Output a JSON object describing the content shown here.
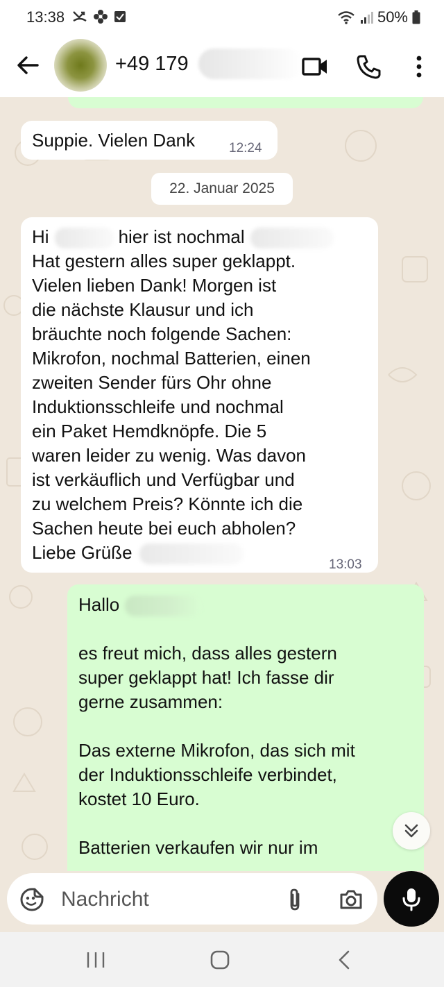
{
  "status_bar": {
    "time": "13:38",
    "battery": "50%",
    "icons": [
      "missed-call-icon",
      "flower-icon",
      "checkbox-icon",
      "wifi-icon",
      "signal-icon",
      "battery-icon"
    ]
  },
  "header": {
    "contact_number": "+49 179",
    "icons": [
      "back-arrow-icon",
      "video-call-icon",
      "phone-icon",
      "more-vertical-icon"
    ]
  },
  "messages": [
    {
      "direction": "incoming",
      "text": "Suppie. Vielen Dank",
      "time": "12:24"
    },
    {
      "type": "date",
      "text": "22. Januar 2025"
    },
    {
      "direction": "incoming",
      "lines": [
        "Hi",
        "hier ist nochmal",
        "Hat gestern alles super geklappt.",
        "Vielen lieben Dank! Morgen ist",
        "die nächste Klausur und ich",
        "bräuchte noch folgende Sachen:",
        "Mikrofon, nochmal Batterien, einen",
        "zweiten Sender fürs Ohr ohne",
        "Induktionsschleife und nochmal",
        "ein Paket Hemdknöpfe. Die 5",
        "waren leider zu wenig. Was davon",
        "ist verkäuflich und Verfügbar und",
        "zu welchem Preis? Könnte ich die",
        "Sachen heute bei euch abholen?",
        "Liebe Grüße"
      ],
      "time": "13:03"
    },
    {
      "direction": "outgoing",
      "lines": [
        "Hallo",
        "",
        "es freut mich, dass alles gestern",
        "super geklappt hat! Ich fasse dir",
        "gerne zusammen:",
        "",
        "Das externe Mikrofon, das sich mit",
        "der Induktionsschleife verbindet,",
        "kostet 10 Euro.",
        "",
        "Batterien verkaufen wir nur im"
      ]
    }
  ],
  "input": {
    "placeholder": "Nachricht"
  },
  "colors": {
    "incoming_bubble": "#ffffff",
    "outgoing_bubble": "#d8fdd2",
    "chat_background": "#efe7dc",
    "mic_button": "#0b0b0b"
  }
}
